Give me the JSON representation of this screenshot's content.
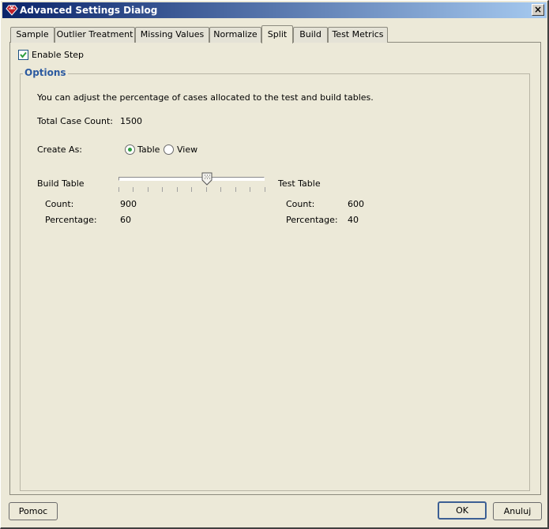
{
  "window": {
    "title": "Advanced Settings Dialog",
    "close_label": "×"
  },
  "tabs": [
    {
      "label": "Sample",
      "active": false
    },
    {
      "label": "Outlier Treatment",
      "active": false
    },
    {
      "label": "Missing Values",
      "active": false
    },
    {
      "label": "Normalize",
      "active": false
    },
    {
      "label": "Split",
      "active": true
    },
    {
      "label": "Build",
      "active": false
    },
    {
      "label": "Test Metrics",
      "active": false
    }
  ],
  "enable_step": {
    "label": "Enable Step",
    "checked": true
  },
  "options": {
    "title": "Options",
    "description": "You can adjust the percentage of cases allocated to the test and build tables.",
    "total_case_count_label": "Total Case Count:",
    "total_case_count_value": "1500",
    "create_as_label": "Create As:",
    "create_as_options": [
      {
        "label": "Table",
        "selected": true
      },
      {
        "label": "View",
        "selected": false
      }
    ],
    "build_table": {
      "title": "Build Table",
      "count_label": "Count:",
      "count_value": "900",
      "percentage_label": "Percentage:",
      "percentage_value": "60"
    },
    "test_table": {
      "title": "Test Table",
      "count_label": "Count:",
      "count_value": "600",
      "percentage_label": "Percentage:",
      "percentage_value": "40"
    },
    "split_slider_percent": 60
  },
  "buttons": {
    "help_label": "Pomoc",
    "ok_label": "OK",
    "cancel_label": "Anuluj"
  },
  "colors": {
    "titlebar_start": "#0a246a",
    "titlebar_end": "#a6caf0",
    "group_title": "#2c5aa0",
    "checkmark": "#2f9e3f"
  }
}
